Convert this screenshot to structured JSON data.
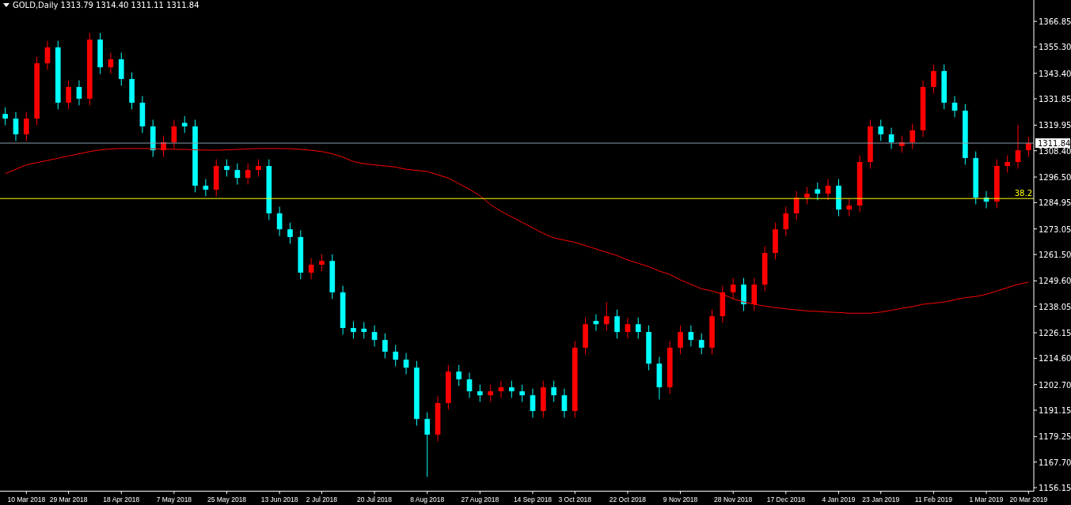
{
  "chart": {
    "header": "GOLD,Daily 1313.79 1314.40 1311.11 1311.84",
    "chart_data": {
      "type": "candlestick",
      "ylim": [
        1155.1,
        1376.5
      ],
      "categories": [
        null,
        null,
        "10 Mar 2018",
        null,
        null,
        null,
        "29 Mar 2018",
        null,
        null,
        null,
        null,
        "18 Apr 2018",
        null,
        null,
        null,
        null,
        "7 May 2018",
        null,
        null,
        null,
        null,
        "25 May 2018",
        null,
        null,
        null,
        null,
        "13 Jun 2018",
        null,
        null,
        null,
        "2 Jul 2018",
        null,
        null,
        null,
        null,
        "20 Jul 2018",
        null,
        null,
        null,
        null,
        "8 Aug 2018",
        null,
        null,
        null,
        null,
        "27 Aug 2018",
        null,
        null,
        null,
        null,
        "14 Sep 2018",
        null,
        null,
        null,
        "3 Oct 2018",
        null,
        null,
        null,
        null,
        "22 Oct 2018",
        null,
        null,
        null,
        null,
        "9 Nov 2018",
        null,
        null,
        null,
        null,
        "28 Nov 2018",
        null,
        null,
        null,
        null,
        "17 Dec 2018",
        null,
        null,
        null,
        null,
        "4 Jan 2019",
        null,
        null,
        null,
        "23 Jan 2019",
        null,
        null,
        null,
        null,
        "11 Feb 2019",
        null,
        null,
        null,
        null,
        "1 Mar 2019",
        null,
        null,
        null,
        "20 Mar 2019"
      ],
      "ohlc": [
        [
          1325.0,
          1328.0,
          1319.9,
          1322.9
        ],
        [
          1322.9,
          1325.9,
          1312.8,
          1315.8
        ],
        [
          1315.8,
          1325.9,
          1312.8,
          1322.9
        ],
        [
          1322.9,
          1350.9,
          1319.9,
          1347.9
        ],
        [
          1347.9,
          1358.1,
          1344.9,
          1355.1
        ],
        [
          1355.1,
          1358.1,
          1327.1,
          1330.1
        ],
        [
          1330.1,
          1340.2,
          1327.1,
          1337.2
        ],
        [
          1337.2,
          1340.2,
          1328.9,
          1331.9
        ],
        [
          1331.9,
          1361.6,
          1328.9,
          1358.6
        ],
        [
          1358.6,
          1361.6,
          1343.1,
          1346.1
        ],
        [
          1346.1,
          1352.7,
          1343.1,
          1349.7
        ],
        [
          1349.7,
          1352.7,
          1337.8,
          1340.8
        ],
        [
          1340.8,
          1343.8,
          1327.1,
          1330.1
        ],
        [
          1330.1,
          1333.1,
          1316.4,
          1319.4
        ],
        [
          1319.4,
          1322.4,
          1305.6,
          1308.6
        ],
        [
          1308.6,
          1315.2,
          1305.6,
          1312.2
        ],
        [
          1312.2,
          1322.4,
          1309.2,
          1319.4
        ],
        [
          1321.0,
          1324.0,
          1316.4,
          1319.4
        ],
        [
          1319.4,
          1322.4,
          1289.6,
          1292.6
        ],
        [
          1292.6,
          1295.6,
          1287.8,
          1290.8
        ],
        [
          1290.8,
          1304.5,
          1287.8,
          1301.5
        ],
        [
          1301.5,
          1304.5,
          1296.7,
          1299.7
        ],
        [
          1299.7,
          1302.7,
          1293.1,
          1296.1
        ],
        [
          1296.1,
          1302.7,
          1293.1,
          1299.7
        ],
        [
          1299.7,
          1304.5,
          1296.7,
          1301.5
        ],
        [
          1301.5,
          1304.5,
          1277.1,
          1280.1
        ],
        [
          1280.1,
          1283.1,
          1269.9,
          1272.9
        ],
        [
          1272.9,
          1275.9,
          1266.4,
          1269.4
        ],
        [
          1269.4,
          1272.4,
          1250.3,
          1253.3
        ],
        [
          1253.3,
          1259.9,
          1250.3,
          1256.9
        ],
        [
          1256.9,
          1261.6,
          1253.9,
          1258.6
        ],
        [
          1258.6,
          1261.6,
          1241.4,
          1244.4
        ],
        [
          1244.4,
          1247.4,
          1225.3,
          1228.3
        ],
        [
          1228.3,
          1231.3,
          1223.5,
          1226.5
        ],
        [
          1228.0,
          1231.0,
          1223.5,
          1226.5
        ],
        [
          1226.5,
          1229.5,
          1219.9,
          1222.9
        ],
        [
          1222.9,
          1225.9,
          1214.6,
          1217.6
        ],
        [
          1217.6,
          1220.6,
          1211.0,
          1214.0
        ],
        [
          1214.0,
          1217.0,
          1207.4,
          1210.4
        ],
        [
          1210.4,
          1213.4,
          1184.2,
          1187.2
        ],
        [
          1187.2,
          1190.2,
          1161.0,
          1180.1
        ],
        [
          1180.1,
          1197.4,
          1177.1,
          1194.4
        ],
        [
          1194.4,
          1211.6,
          1191.4,
          1208.6
        ],
        [
          1208.6,
          1211.6,
          1202.1,
          1205.1
        ],
        [
          1205.1,
          1208.1,
          1196.7,
          1199.7
        ],
        [
          1199.7,
          1202.7,
          1194.9,
          1197.9
        ],
        [
          1197.9,
          1202.7,
          1194.9,
          1199.7
        ],
        [
          1199.7,
          1204.5,
          1196.7,
          1201.5
        ],
        [
          1201.5,
          1204.5,
          1196.7,
          1199.7
        ],
        [
          1199.7,
          1202.7,
          1194.9,
          1197.9
        ],
        [
          1197.9,
          1200.9,
          1187.8,
          1190.8
        ],
        [
          1190.8,
          1204.5,
          1187.8,
          1201.5
        ],
        [
          1201.5,
          1204.5,
          1194.9,
          1197.9
        ],
        [
          1197.9,
          1200.9,
          1187.8,
          1190.8
        ],
        [
          1190.8,
          1222.4,
          1187.8,
          1219.4
        ],
        [
          1219.4,
          1233.0,
          1216.4,
          1230.0
        ],
        [
          1231.5,
          1234.5,
          1227.0,
          1230.0
        ],
        [
          1230.0,
          1240.0,
          1227.0,
          1233.6
        ],
        [
          1233.6,
          1236.6,
          1223.5,
          1226.5
        ],
        [
          1226.5,
          1233.0,
          1223.5,
          1230.0
        ],
        [
          1230.0,
          1233.0,
          1223.5,
          1226.5
        ],
        [
          1226.5,
          1229.5,
          1209.2,
          1212.2
        ],
        [
          1212.2,
          1215.2,
          1196.0,
          1201.5
        ],
        [
          1201.5,
          1222.4,
          1198.5,
          1219.4
        ],
        [
          1219.4,
          1229.5,
          1216.4,
          1226.5
        ],
        [
          1226.5,
          1229.5,
          1219.9,
          1222.9
        ],
        [
          1222.9,
          1225.9,
          1216.4,
          1219.4
        ],
        [
          1219.4,
          1236.6,
          1216.4,
          1233.6
        ],
        [
          1233.6,
          1247.4,
          1230.6,
          1244.4
        ],
        [
          1244.4,
          1250.9,
          1241.4,
          1247.9
        ],
        [
          1247.9,
          1250.9,
          1236.0,
          1239.0
        ],
        [
          1239.0,
          1250.9,
          1236.0,
          1247.9
        ],
        [
          1247.9,
          1265.2,
          1244.9,
          1262.2
        ],
        [
          1262.2,
          1275.9,
          1259.2,
          1272.9
        ],
        [
          1272.9,
          1283.1,
          1269.9,
          1280.1
        ],
        [
          1280.1,
          1290.2,
          1277.1,
          1287.2
        ],
        [
          1287.2,
          1292.0,
          1284.2,
          1289.0
        ],
        [
          1291.0,
          1294.0,
          1286.0,
          1289.0
        ],
        [
          1289.0,
          1295.6,
          1286.0,
          1292.6
        ],
        [
          1292.6,
          1295.6,
          1278.8,
          1281.8
        ],
        [
          1281.8,
          1286.6,
          1278.8,
          1283.6
        ],
        [
          1283.6,
          1306.3,
          1280.6,
          1303.3
        ],
        [
          1303.3,
          1322.4,
          1300.3,
          1319.4
        ],
        [
          1319.4,
          1322.4,
          1312.8,
          1315.8
        ],
        [
          1315.8,
          1318.8,
          1309.2,
          1312.2
        ],
        [
          1310.5,
          1315.2,
          1307.5,
          1312.2
        ],
        [
          1312.2,
          1320.6,
          1309.2,
          1317.6
        ],
        [
          1317.6,
          1340.2,
          1314.6,
          1337.2
        ],
        [
          1337.2,
          1347.4,
          1334.2,
          1344.4
        ],
        [
          1344.4,
          1347.4,
          1327.1,
          1330.1
        ],
        [
          1330.1,
          1333.1,
          1323.5,
          1326.5
        ],
        [
          1326.5,
          1329.5,
          1302.1,
          1305.1
        ],
        [
          1305.1,
          1308.1,
          1284.2,
          1287.2
        ],
        [
          1287.2,
          1290.2,
          1282.4,
          1285.4
        ],
        [
          1285.4,
          1304.5,
          1282.4,
          1301.5
        ],
        [
          1301.5,
          1306.3,
          1298.5,
          1303.3
        ],
        [
          1303.3,
          1320.0,
          1300.3,
          1308.6
        ],
        [
          1308.6,
          1314.8,
          1305.6,
          1311.8
        ]
      ],
      "series": [
        {
          "type": "line",
          "color": "#ff0000",
          "values": [
            1298.0,
            1300,
            1302,
            1303,
            1304,
            1305,
            1306,
            1307,
            1308,
            1308.8,
            1309.2,
            1309.4,
            1309.4,
            1309.4,
            1309.3,
            1309.2,
            1309,
            1309,
            1308.8,
            1308.7,
            1308.6,
            1308.8,
            1309,
            1309.2,
            1309.4,
            1309.4,
            1309.4,
            1309.3,
            1309,
            1308.6,
            1308,
            1307,
            1305.5,
            1303.5,
            1302.5,
            1302,
            1301.5,
            1301,
            1300,
            1299.5,
            1299,
            1297.5,
            1296,
            1293.5,
            1291,
            1288,
            1284,
            1281,
            1278.5,
            1276,
            1273.5,
            1271,
            1269,
            1268,
            1267,
            1265.5,
            1264,
            1262.5,
            1261,
            1259,
            1257.5,
            1256,
            1254,
            1252.5,
            1250,
            1248,
            1246,
            1245,
            1243.5,
            1241.5,
            1240,
            1239,
            1238.2,
            1237.5,
            1237,
            1236.5,
            1236,
            1235.8,
            1235.5,
            1235.3,
            1235,
            1235,
            1235,
            1235.5,
            1236.3,
            1237.2,
            1238,
            1239,
            1239.5,
            1240,
            1241,
            1242,
            1242.5,
            1243.5,
            1245,
            1246.5,
            1248,
            1249
          ]
        }
      ],
      "yticks": [
        {
          "value": 1366.85,
          "label": "1366.85"
        },
        {
          "value": 1355.3,
          "label": "1355.30"
        },
        {
          "value": 1343.4,
          "label": "1343.40"
        },
        {
          "value": 1331.85,
          "label": "1331.85"
        },
        {
          "value": 1319.95,
          "label": "1319.95"
        },
        {
          "value": 1308.4,
          "label": "1308.40"
        },
        {
          "value": 1296.5,
          "label": "1296.50"
        },
        {
          "value": 1284.95,
          "label": "1284.95"
        },
        {
          "value": 1273.05,
          "label": "1273.05"
        },
        {
          "value": 1261.5,
          "label": "1261.50"
        },
        {
          "value": 1249.6,
          "label": "1249.60"
        },
        {
          "value": 1238.05,
          "label": "1238.05"
        },
        {
          "value": 1226.15,
          "label": "1226.15"
        },
        {
          "value": 1214.6,
          "label": "1214.60"
        },
        {
          "value": 1202.7,
          "label": "1202.70"
        },
        {
          "value": 1191.15,
          "label": "1191.15"
        },
        {
          "value": 1179.25,
          "label": "1179.25"
        },
        {
          "value": 1167.7,
          "label": "1167.70"
        },
        {
          "value": 1156.15,
          "label": "1156.15"
        }
      ],
      "ref_lines": [
        {
          "axis": "y",
          "value": 1311.84,
          "label": "1311.84",
          "color": "#8a9aa8"
        },
        {
          "axis": "y",
          "value": 1286.8,
          "color": "#ffff00"
        }
      ],
      "annotations": [
        {
          "text": "38.2",
          "y": 1286.8
        }
      ]
    }
  }
}
